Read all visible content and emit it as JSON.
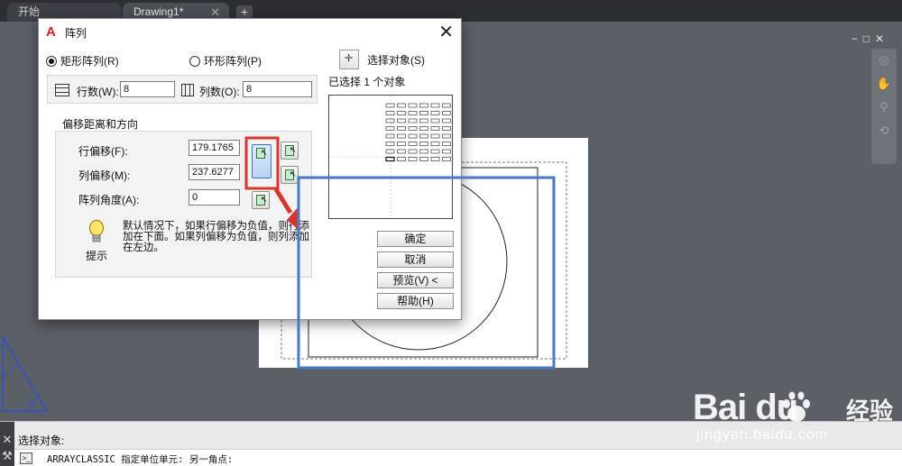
{
  "tabs": [
    {
      "label": "开始"
    },
    {
      "label": "Drawing1*",
      "close": "✕"
    }
  ],
  "tab_add": "+",
  "window_controls": "−□✕",
  "dialog": {
    "title": "阵列",
    "close": "✕",
    "radio_rect": "矩形阵列(R)",
    "radio_polar": "环形阵列(P)",
    "rows_label": "行数(W):",
    "rows_value": "8",
    "cols_label": "列数(O):",
    "cols_value": "8",
    "offset_group_title": "偏移距离和方向",
    "row_offset_label": "行偏移(F):",
    "row_offset_value": "179.1765",
    "col_offset_label": "列偏移(M):",
    "col_offset_value": "237.6277",
    "angle_label": "阵列角度(A):",
    "angle_value": "0",
    "tip_label": "提示",
    "tip_text": "默认情况下，如果行偏移为负值，则行添加在下面。如果列偏移为负值，则列添加在左边。",
    "select_label": "选择对象(S)",
    "selected_count": "已选择 1 个对象",
    "btn_ok": "确定",
    "btn_cancel": "取消",
    "btn_preview": "预览(V) <",
    "btn_help": "帮助(H)"
  },
  "command": {
    "history": "选择对象:",
    "line": "ARRAYCLASSIC 指定单位单元:  另一角点:"
  },
  "watermark": {
    "brand": "Bai du",
    "cn": "经验",
    "url": "jingyan.baidu.com"
  },
  "colors": {
    "accent_red": "#d9352d",
    "highlight_blue": "#4a78c2",
    "autocad_red": "#d8232a"
  }
}
